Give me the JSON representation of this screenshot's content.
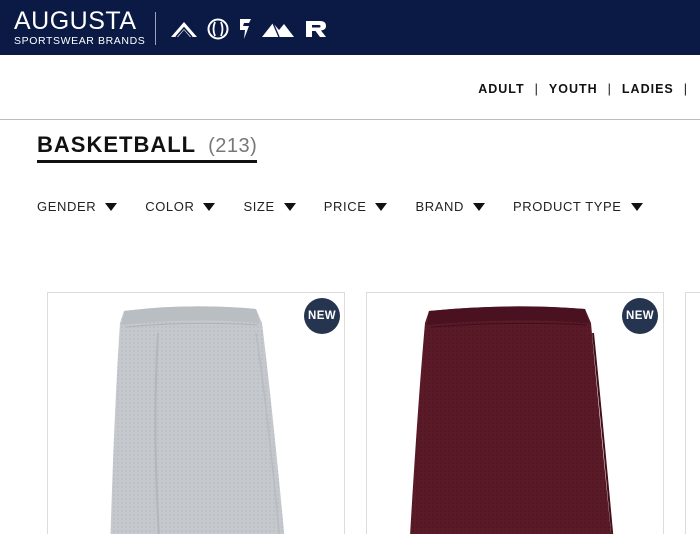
{
  "brand": {
    "logo_main": "AUGUSTA",
    "logo_sub": "SPORTSWEAR BRANDS",
    "icons": [
      "alleson-icon",
      "holloway-icon",
      "high-five-icon",
      "pennant-icon",
      "russell-icon"
    ]
  },
  "nav": {
    "items": [
      "ADULT",
      "YOUTH",
      "LADIES"
    ],
    "separator": "|"
  },
  "heading": {
    "title": "BASKETBALL",
    "count": "(213)"
  },
  "filters": [
    "GENDER",
    "COLOR",
    "SIZE",
    "PRICE",
    "BRAND",
    "PRODUCT TYPE"
  ],
  "products": [
    {
      "badge": "NEW",
      "color_name": "silver",
      "color": "#c5c9cd"
    },
    {
      "badge": "NEW",
      "color_name": "maroon",
      "color": "#5a1a28"
    }
  ],
  "colors": {
    "topbar": "#0b1a45",
    "badge": "#26354f"
  }
}
